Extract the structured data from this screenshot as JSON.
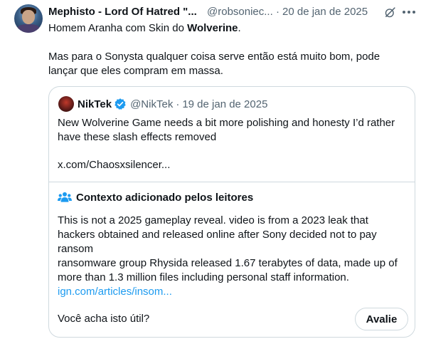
{
  "tweet": {
    "display_name": "Mephisto - Lord Of Hatred \"...",
    "handle": "@robsoniec...",
    "separator": "·",
    "date": "20 de jan de 2025",
    "text_line1_prefix": "Homem Aranha com Skin do ",
    "text_line1_bold": "Wolverine",
    "text_line1_suffix": ".",
    "text_line2": "Mas para o Sonysta qualquer coisa serve então está muito bom, pode",
    "text_line3": "lançar que eles compram em massa.",
    "icons": {
      "avatar": "user-avatar",
      "grok": "grok-icon",
      "more": "more-options-icon"
    }
  },
  "quoted": {
    "display_name": "NikTek",
    "handle": "@NikTek",
    "separator": "·",
    "date": "19 de jan de 2025",
    "verified_color": "#1d9bf0",
    "text_line1": "New Wolverine Game needs a bit more polishing and honesty I’d rather",
    "text_line2": "have these slash effects removed",
    "link": "x.com/Chaosxsilencer..."
  },
  "community_note": {
    "title": "Contexto adicionado pelos leitores",
    "line1": "This is not a 2025 gameplay reveal. video is from a 2023 leak that",
    "line2": "hackers obtained and released online after Sony decided not to pay",
    "line3": "ransom",
    "line4": "ransomware group Rhysida released 1.67 terabytes of data, made up of",
    "line5": "more than 1.3 million files including personal staff information.",
    "link": "ign.com/articles/insom...",
    "helpful_question": "Você acha isto útil?",
    "rate_button": "Avalie",
    "icon": "people-icon",
    "accent_color": "#1d9bf0"
  }
}
